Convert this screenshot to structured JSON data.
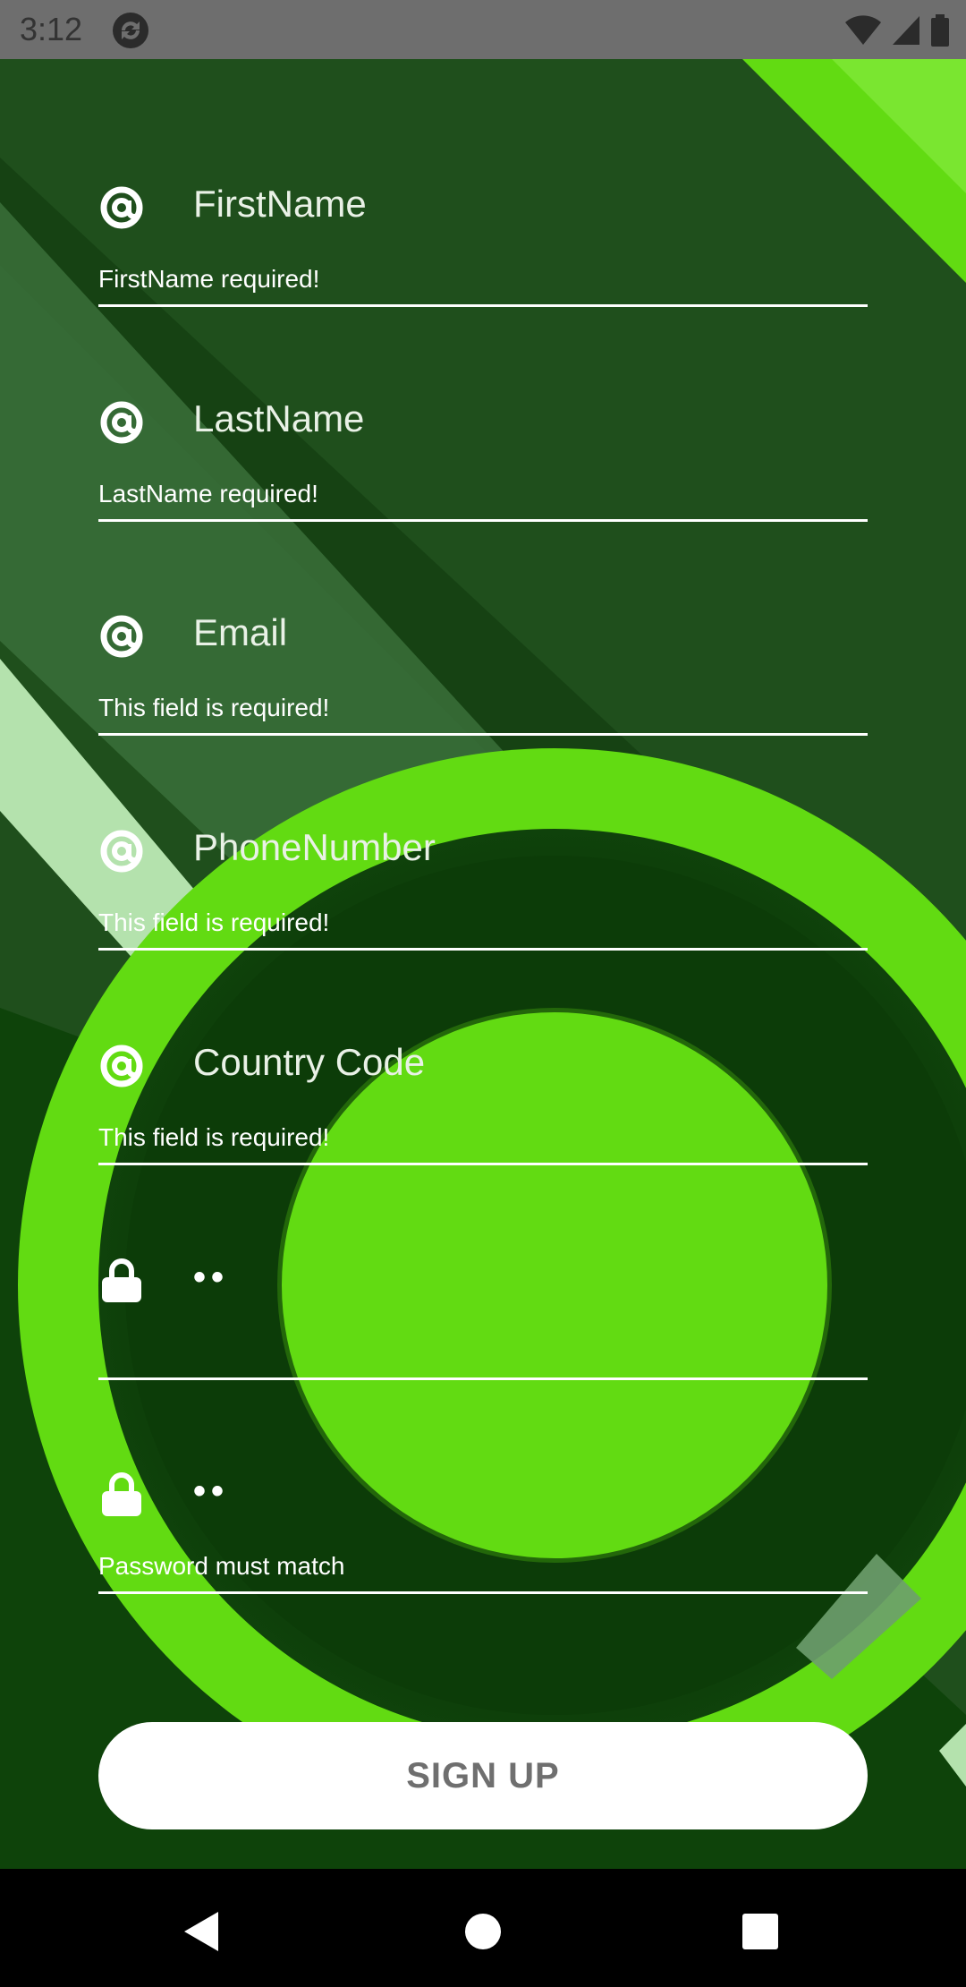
{
  "status_bar": {
    "time": "3:12",
    "app_icon": "sync-icon",
    "indicators": [
      "wifi-icon",
      "signal-icon",
      "battery-icon"
    ]
  },
  "form": {
    "fields": [
      {
        "icon": "at-icon",
        "label": "FirstName",
        "error": "FirstName required!"
      },
      {
        "icon": "at-icon",
        "label": "LastName",
        "error": "LastName required!"
      },
      {
        "icon": "at-icon",
        "label": "Email",
        "error": "This field is required!"
      },
      {
        "icon": "at-icon",
        "label": "PhoneNumber",
        "error": "This field is required!"
      },
      {
        "icon": "at-icon",
        "label": "Country Code",
        "error": "This field is required!"
      },
      {
        "icon": "lock-icon",
        "value": "••",
        "error": ""
      },
      {
        "icon": "lock-icon",
        "value": "••",
        "error": "Password must match"
      }
    ],
    "submit_label": "SIGN UP"
  },
  "navigation_bar": {
    "buttons": [
      "back-icon",
      "home-icon",
      "recents-icon"
    ]
  },
  "colors": {
    "background_dark": "#1f4f1c",
    "accent_green": "#62db12",
    "button_text": "#6f6f6f"
  }
}
